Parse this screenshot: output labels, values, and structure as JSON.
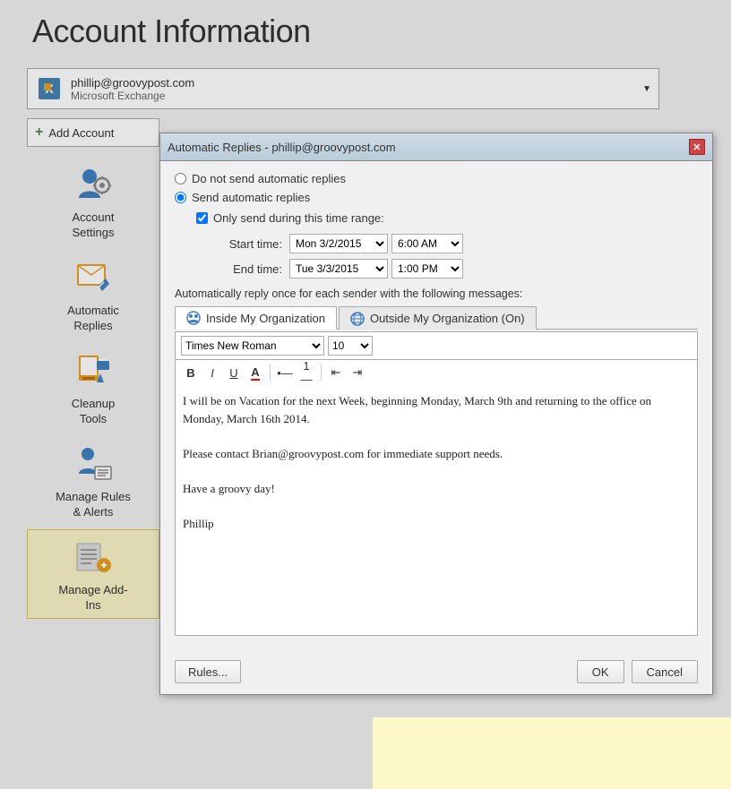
{
  "page": {
    "title": "Account Information"
  },
  "account": {
    "email": "phillip@groovypost.com",
    "type": "Microsoft Exchange",
    "arrow": "▼"
  },
  "addAccount": {
    "label": "Add Account"
  },
  "sidebar": {
    "items": [
      {
        "id": "account-settings",
        "label": "Account\nSettings",
        "active": false
      },
      {
        "id": "automatic-replies",
        "label": "Automatic\nReplies",
        "active": false
      },
      {
        "id": "cleanup-tools",
        "label": "Cleanup\nTools",
        "active": false
      },
      {
        "id": "manage-rules",
        "label": "Manage Rules\n& Alerts",
        "active": false
      },
      {
        "id": "manage-addins",
        "label": "Manage Add-\nIns",
        "active": true
      }
    ]
  },
  "dialog": {
    "title": "Automatic Replies - phillip@groovypost.com",
    "closeLabel": "✕",
    "doNotSendLabel": "Do not send automatic replies",
    "sendAutoLabel": "Send automatic replies",
    "onlySendLabel": "Only send during this time range:",
    "startLabel": "Start time:",
    "endLabel": "End time:",
    "startDate": "Mon 3/2/2015",
    "startTime": "6:00 AM",
    "endDate": "Tue 3/3/2015",
    "endTime": "1:00 PM",
    "autoDesc": "Automatically reply once for each sender with the following messages:",
    "tabs": [
      {
        "id": "inside",
        "label": "Inside My Organization",
        "active": true
      },
      {
        "id": "outside",
        "label": "Outside My Organization (On)",
        "active": false
      }
    ],
    "font": "Times New Roman",
    "fontSize": "10",
    "toolbar": {
      "bold": "B",
      "italic": "I",
      "underline": "U",
      "fontColor": "A",
      "bullets": "≡",
      "numbering": "≡",
      "decreaseIndent": "←≡",
      "increaseIndent": "≡→"
    },
    "messageText": "I will be on Vacation for the next Week, beginning Monday, March 9th and returning to the office on Monday, March 16th 2014.\n\nPlease contact Brian@groovypost.com for immediate support needs.\n\nHave a groovy day!\n\nPhillip",
    "rulesBtn": "Rules...",
    "okBtn": "OK",
    "cancelBtn": "Cancel"
  }
}
